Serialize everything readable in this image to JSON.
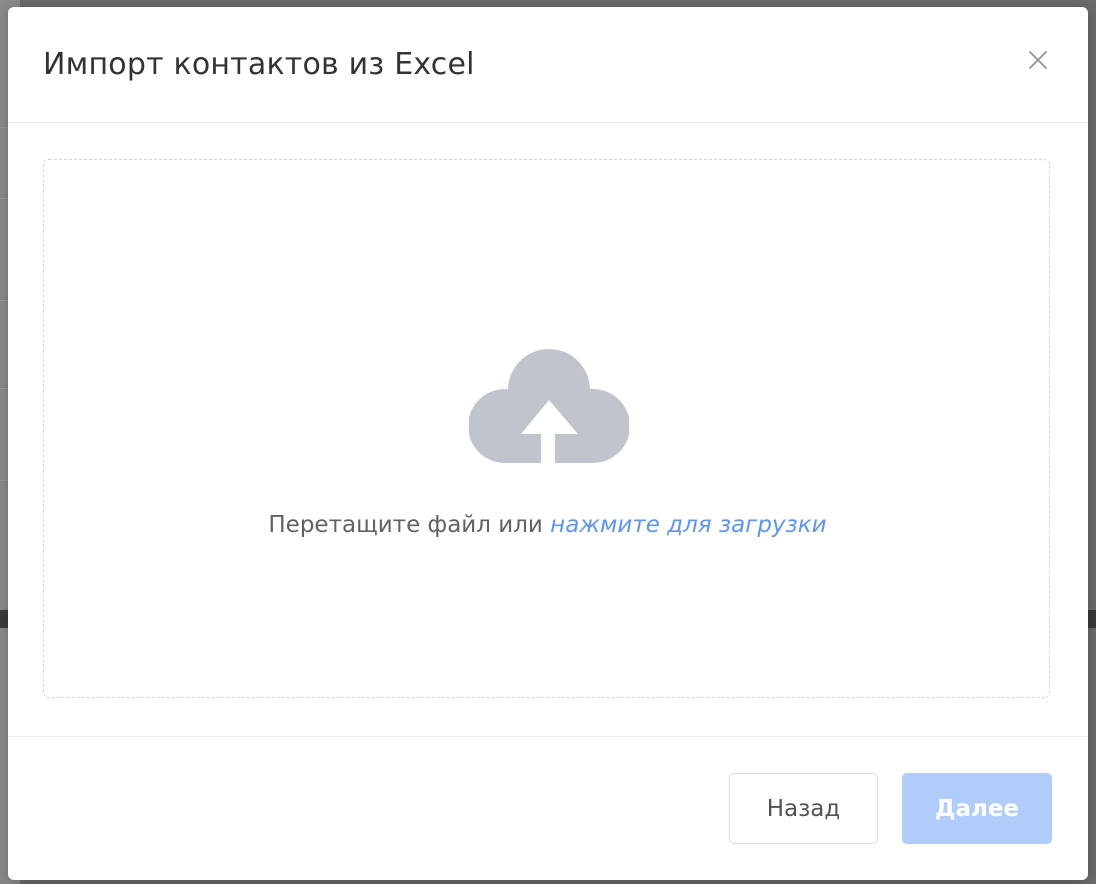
{
  "modal": {
    "title": "Импорт контактов из Excel"
  },
  "dropzone": {
    "text": "Перетащите файл или ",
    "link_text": "нажмите для загрузки",
    "icon": "cloud-upload-icon",
    "icon_color": "#c0c4cc",
    "link_color": "#5f95ec"
  },
  "footer": {
    "back_label": "Назад",
    "next_label": "Далее",
    "next_disabled": true
  },
  "icons": {
    "close": "close-icon"
  }
}
